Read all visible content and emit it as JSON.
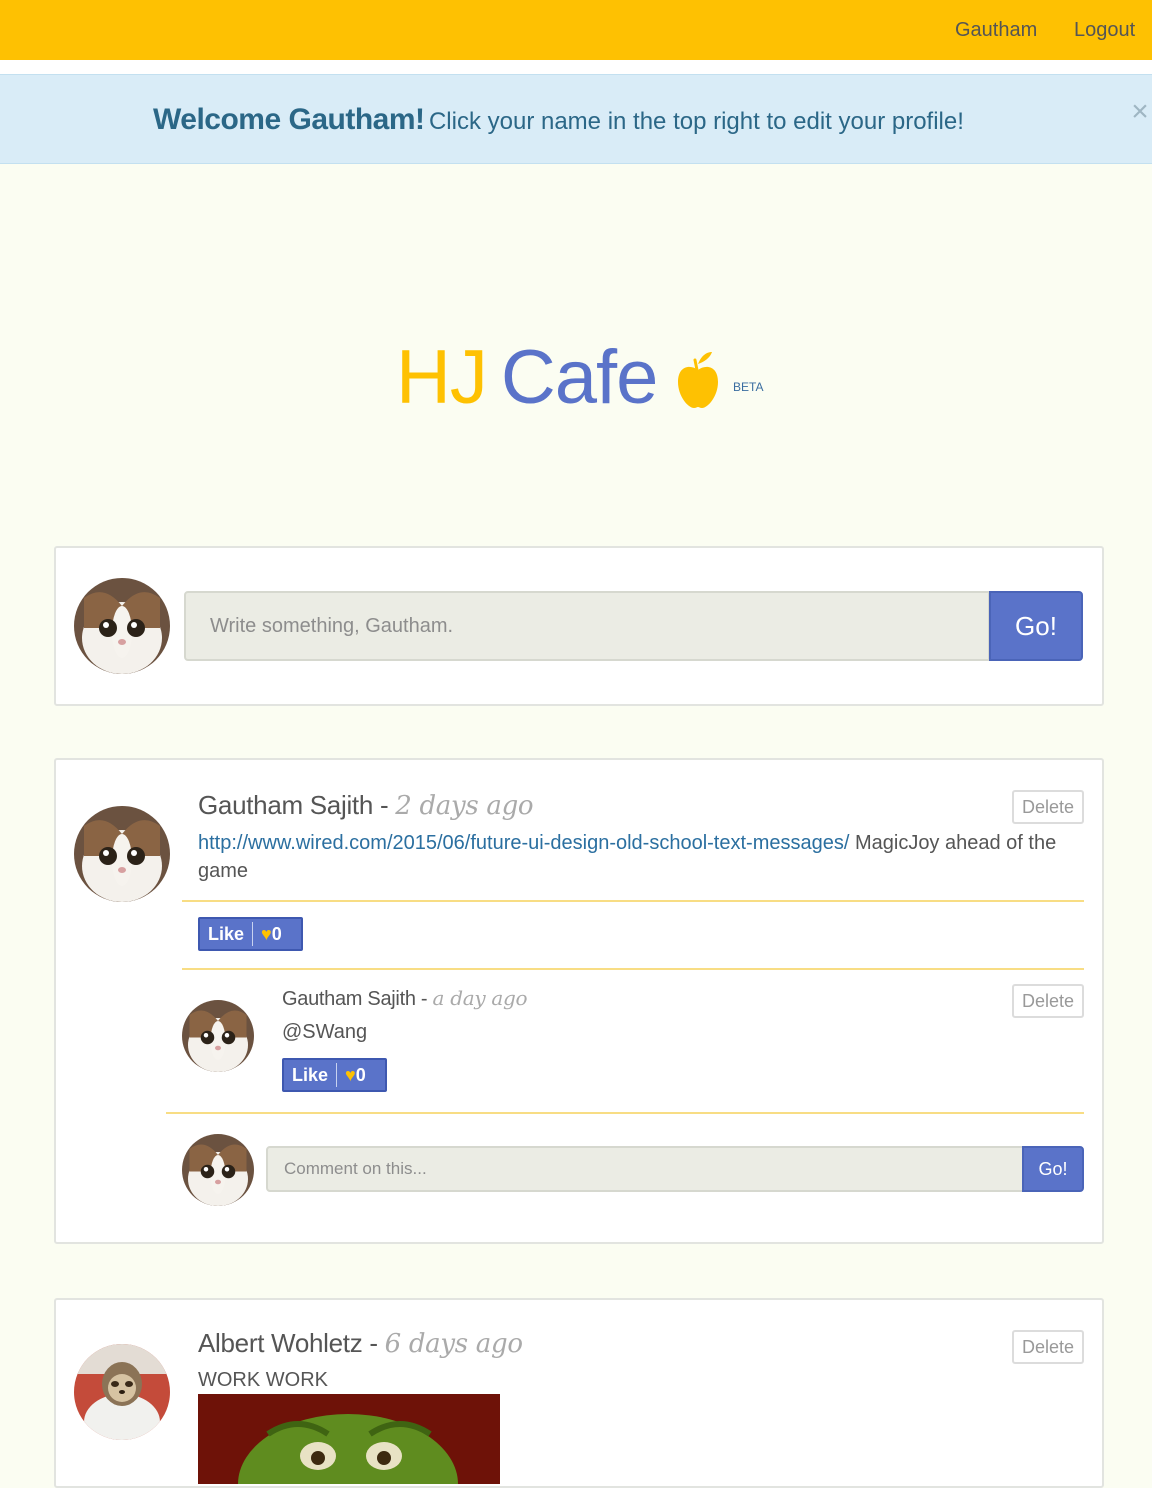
{
  "navbar": {
    "user_link": "Gautham",
    "logout_link": "Logout"
  },
  "alert": {
    "strong": "Welcome Gautham!",
    "message": "Click your name in the top right to edit your profile!",
    "close": "×"
  },
  "logo": {
    "part1": "HJ",
    "part2": "Cafe",
    "badge": "BETA"
  },
  "composer": {
    "placeholder": "Write something, Gautham.",
    "submit_label": "Go!"
  },
  "posts": [
    {
      "author": "Gautham Sajith",
      "separator": " - ",
      "time": "2 days ago",
      "delete_label": "Delete",
      "link": "http://www.wired.com/2015/06/future-ui-design-old-school-text-messages/",
      "text": " MagicJoy ahead of the game",
      "like_label": "Like",
      "like_count": "0",
      "comments": [
        {
          "author": "Gautham Sajith",
          "separator": " - ",
          "time": "a day ago",
          "delete_label": "Delete",
          "text": "@SWang",
          "like_label": "Like",
          "like_count": "0"
        }
      ],
      "comment_input": {
        "placeholder": "Comment on this...",
        "submit_label": "Go!"
      }
    },
    {
      "author": "Albert Wohletz",
      "separator": " - ",
      "time": "6 days ago",
      "delete_label": "Delete",
      "text": "WORK WORK"
    }
  ],
  "colors": {
    "navbar": "#fec102",
    "accent": "#5a73c9",
    "background": "#fbfdf2",
    "alert_bg": "#d9ecf7"
  }
}
